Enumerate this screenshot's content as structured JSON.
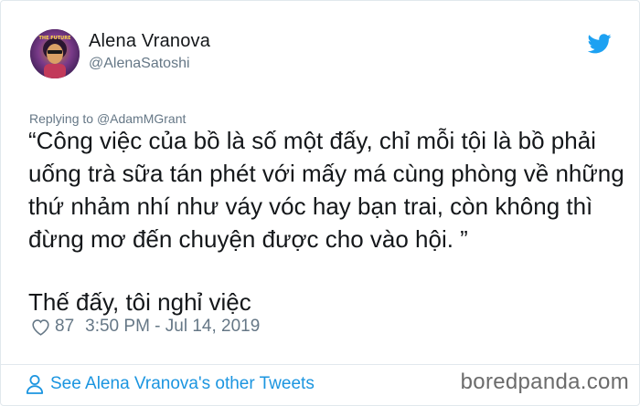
{
  "tweet": {
    "author_name": "Alena Vranova",
    "author_handle": "@AlenaSatoshi",
    "avatar_caption": "THE FUTURE",
    "replying_prefix": "Replying to",
    "replying_to": "@AdamMGrant",
    "text_paragraph_1": "“Công việc của bồ là số một đấy, chỉ mỗi tội là bồ phải uống trà sữa tán phét với mấy má cùng phòng về những thứ nhảm nhí như váy vóc hay bạn trai, còn không thì đừng mơ đến chuyện được cho vào hội. ”",
    "text_paragraph_2": "Thế đấy, tôi nghỉ việc",
    "like_count": "87",
    "timestamp": "3:50 PM - Jul 14, 2019",
    "see_more_label": "See Alena Vranova's other Tweets"
  },
  "watermark": "boredpanda.com",
  "icons": {
    "brand": "twitter-bird-icon",
    "like": "heart-icon",
    "profile": "person-icon"
  },
  "colors": {
    "twitter_blue": "#1da1f2",
    "link_blue": "#1b95e0",
    "secondary_text": "#657786",
    "border": "#e1e8ed"
  }
}
